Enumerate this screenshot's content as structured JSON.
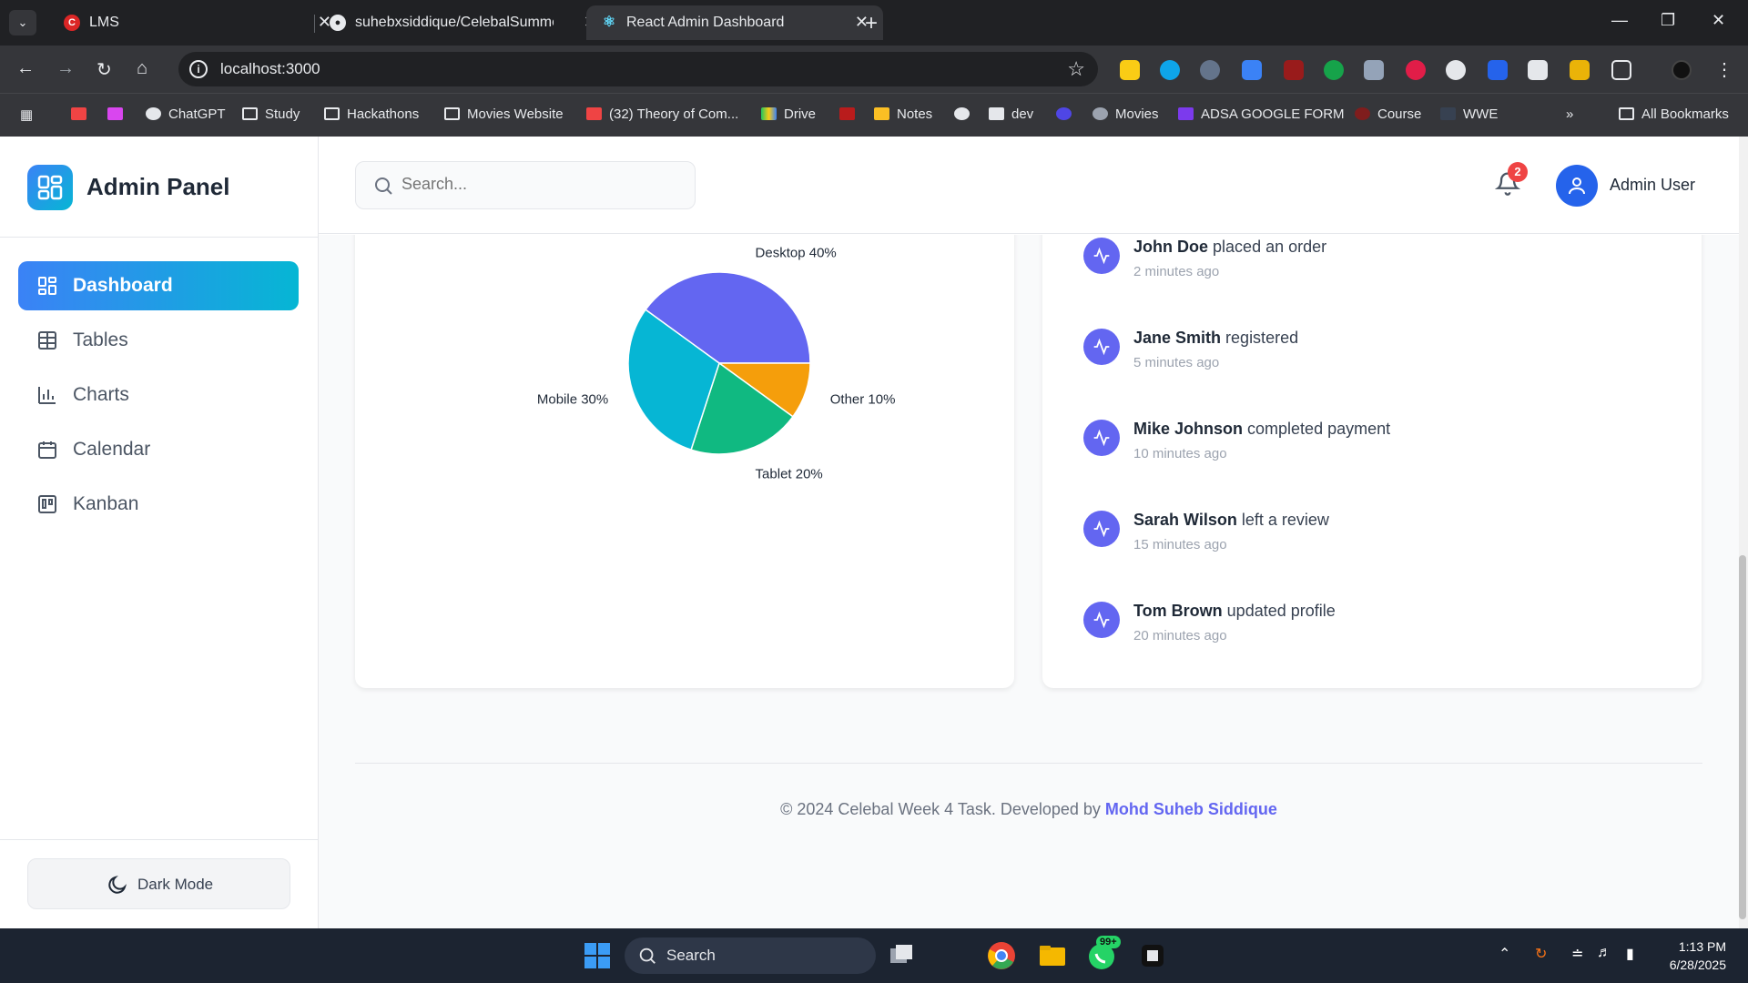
{
  "browser": {
    "tabs": [
      {
        "title": "LMS",
        "favicon": "lms-favicon"
      },
      {
        "title": "suhebxsiddique/CelebalSumme",
        "favicon": "github-icon"
      },
      {
        "title": "React Admin Dashboard",
        "favicon": "react-icon"
      }
    ],
    "url": "localhost:3000",
    "bookmarks": [
      {
        "label": "ChatGPT"
      },
      {
        "label": "Study"
      },
      {
        "label": "Hackathons"
      },
      {
        "label": "Movies Website"
      },
      {
        "label": "(32) Theory of Com..."
      },
      {
        "label": "Drive"
      },
      {
        "label": "Notes"
      },
      {
        "label": "dev"
      },
      {
        "label": "Movies"
      },
      {
        "label": "ADSA GOOGLE FORM"
      },
      {
        "label": "Course"
      },
      {
        "label": "WWE"
      }
    ],
    "all_bookmarks_label": "All Bookmarks"
  },
  "sidebar": {
    "brand": "Admin Panel",
    "items": [
      {
        "label": "Dashboard",
        "icon": "dashboard-icon",
        "active": true
      },
      {
        "label": "Tables",
        "icon": "table-icon"
      },
      {
        "label": "Charts",
        "icon": "bar-chart-icon"
      },
      {
        "label": "Calendar",
        "icon": "calendar-icon"
      },
      {
        "label": "Kanban",
        "icon": "kanban-icon"
      }
    ],
    "dark_mode_label": "Dark Mode"
  },
  "header": {
    "search_placeholder": "Search...",
    "notification_count": "2",
    "user_name": "Admin User"
  },
  "chart_data": {
    "type": "pie",
    "categories": [
      "Desktop",
      "Other",
      "Tablet",
      "Mobile"
    ],
    "values": [
      40,
      10,
      20,
      30
    ],
    "labels": [
      "Desktop 40%",
      "Other 10%",
      "Tablet 20%",
      "Mobile 30%"
    ],
    "colors": [
      "#6366f1",
      "#f59e0b",
      "#10b981",
      "#06b6d4"
    ]
  },
  "activity": [
    {
      "name": "John Doe",
      "action": "placed an order",
      "time": "2 minutes ago"
    },
    {
      "name": "Jane Smith",
      "action": "registered",
      "time": "5 minutes ago"
    },
    {
      "name": "Mike Johnson",
      "action": "completed payment",
      "time": "10 minutes ago"
    },
    {
      "name": "Sarah Wilson",
      "action": "left a review",
      "time": "15 minutes ago"
    },
    {
      "name": "Tom Brown",
      "action": "updated profile",
      "time": "20 minutes ago"
    }
  ],
  "footer": {
    "text": "© 2024 Celebal Week 4 Task. Developed by",
    "author": "Mohd Suheb Siddique"
  },
  "taskbar": {
    "search_label": "Search",
    "whatsapp_badge": "99+",
    "time": "1:13 PM",
    "date": "6/28/2025"
  }
}
